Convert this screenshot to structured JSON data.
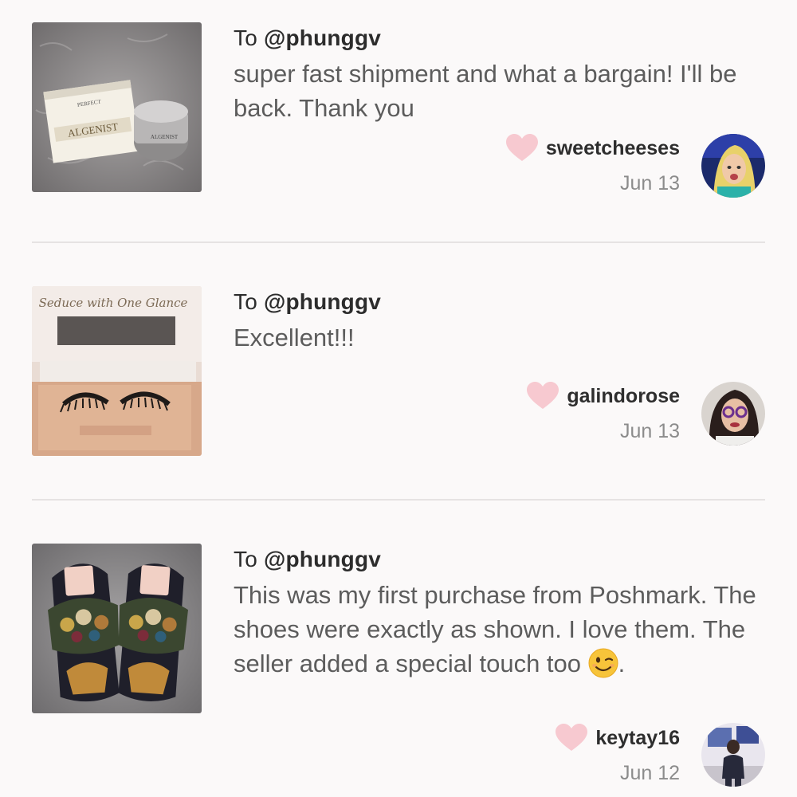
{
  "reviews": [
    {
      "to_prefix": "To",
      "to_handle": "@phunggv",
      "comment": "super fast shipment and what a bargain! I'll be back. Thank you",
      "username": "sweetcheeses",
      "date": "Jun 13",
      "photo_text": [
        "PERFECT",
        "ALGENIST",
        "ALGENIST"
      ]
    },
    {
      "to_prefix": "To",
      "to_handle": "@phunggv",
      "comment": "Excellent!!!",
      "username": "galindorose",
      "date": "Jun 13",
      "photo_text": [
        "Seduce with One Glance"
      ]
    },
    {
      "to_prefix": "To",
      "to_handle": "@phunggv",
      "comment": "This was my first purchase from Poshmark. The shoes were exactly as shown. I love them. The seller added a special touch too",
      "comment_suffix": ".",
      "username": "keytay16",
      "date": "Jun 12"
    }
  ],
  "colors": {
    "heart": "#f7c9d0",
    "divider": "#e6e3e3",
    "background": "#fbf9f9"
  },
  "icons": {
    "like": "heart-icon",
    "emoji": "winking-face-emoji"
  }
}
